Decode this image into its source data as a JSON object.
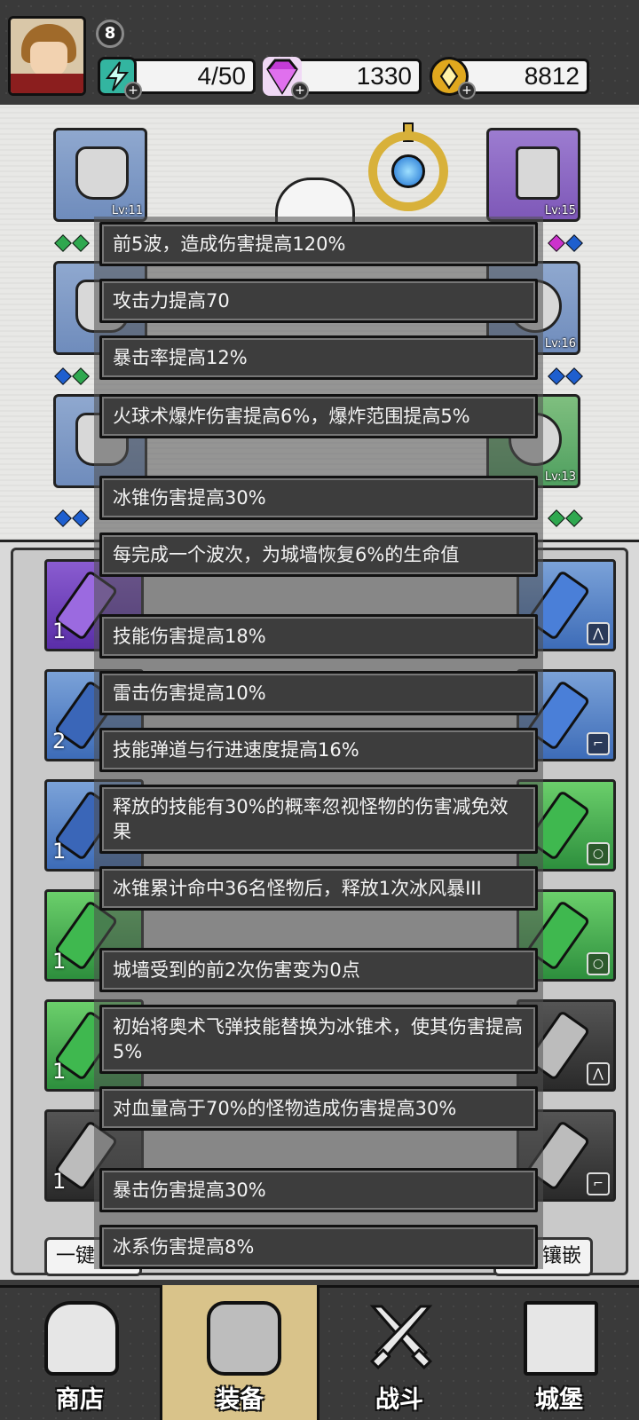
{
  "header": {
    "player_level": "8",
    "energy": "4/50",
    "gems": "1330",
    "gold": "8812",
    "energy_icon": "lightning-icon",
    "gem_icon": "diamond-icon",
    "gold_icon": "coin-icon",
    "plus_symbol": "+",
    "colors": {
      "energy": "#33b5a0",
      "gem": "#c33bd6",
      "gold": "#e0a81e"
    }
  },
  "equipment": {
    "left_top_level": "Lv:11",
    "right_top_level": "Lv:15",
    "right_mid_level": "Lv:16",
    "right_bottom_level": "Lv:13"
  },
  "tooltip": {
    "lines": [
      "前5波，造成伤害提高120%",
      "攻击力提高70",
      "暴击率提高12%",
      "火球术爆炸伤害提高6%，爆炸范围提高5%",
      "冰锥伤害提高30%",
      "每完成一个波次，为城墙恢复6%的生命值",
      "技能伤害提高18%",
      "雷击伤害提高10%",
      "技能弹道与行进速度提高16%",
      "释放的技能有30%的概率忽视怪物的伤害减免效果",
      "冰锥累计命中36名怪物后，释放1次冰风暴III",
      "城墙受到的前2次伤害变为0点",
      "初始将奥术飞弹技能替换为冰锥术，使其伤害提高5%",
      "对血量高于70%的怪物造成伤害提高30%",
      "暴击伤害提高30%",
      "冰系伤害提高8%"
    ]
  },
  "inventory": {
    "row_quantities": [
      "1",
      "2",
      "1",
      "1",
      "1",
      "1"
    ],
    "left_button_partial": "一键",
    "right_button_partial": "镶嵌"
  },
  "nav": {
    "items": [
      {
        "label": "商店",
        "icon": "shop-icon"
      },
      {
        "label": "装备",
        "icon": "backpack-icon"
      },
      {
        "label": "战斗",
        "icon": "crossed-swords-icon"
      },
      {
        "label": "城堡",
        "icon": "castle-icon"
      }
    ],
    "active_index": 1
  }
}
